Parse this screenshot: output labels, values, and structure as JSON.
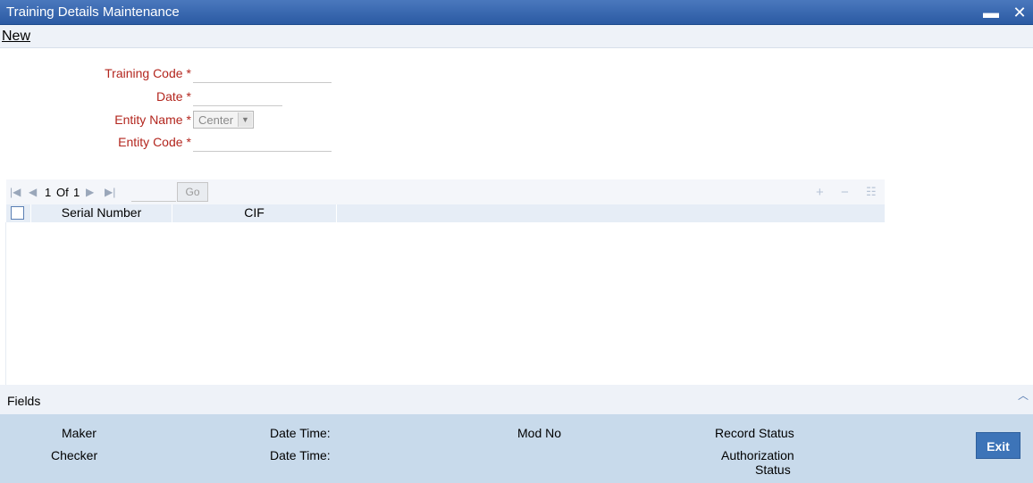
{
  "window": {
    "title": "Training Details Maintenance",
    "minimize_glyph": "▬",
    "close_glyph": "✕"
  },
  "toolbar": {
    "new_label": "New"
  },
  "form": {
    "training_code": {
      "label": "Training Code",
      "required": "*",
      "value": ""
    },
    "date": {
      "label": "Date",
      "required": "*",
      "value": ""
    },
    "entity_name": {
      "label": "Entity Name",
      "required": "*",
      "value": "Center"
    },
    "entity_code": {
      "label": "Entity Code",
      "required": "*",
      "value": ""
    }
  },
  "grid": {
    "pager": {
      "current": "1",
      "of_label": "Of",
      "total": "1",
      "go_label": "Go"
    },
    "columns": [
      "Serial Number",
      "CIF"
    ],
    "icons": {
      "first": "first-page-icon",
      "prev": "prev-page-icon",
      "next": "next-page-icon",
      "last": "last-page-icon",
      "add": "add-row-icon",
      "remove": "delete-row-icon",
      "view": "single-view-icon"
    }
  },
  "fields_bar": {
    "label": "Fields"
  },
  "footer": {
    "maker": "Maker",
    "checker": "Checker",
    "date_time_1": "Date Time:",
    "date_time_2": "Date Time:",
    "mod_no": "Mod No",
    "record_status": "Record Status",
    "authorization_status_line1": "Authorization",
    "authorization_status_line2": "Status",
    "exit_label": "Exit"
  }
}
